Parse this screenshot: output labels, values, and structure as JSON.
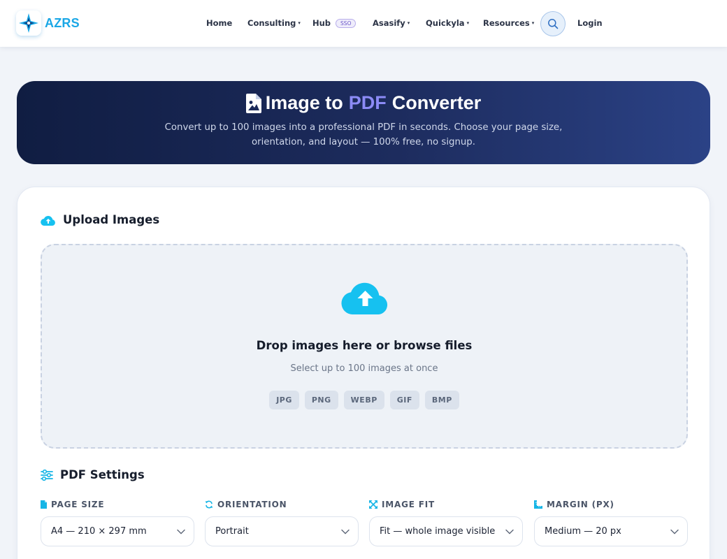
{
  "brand": {
    "name": "AZRS",
    "logo_icon": "compass-star-icon"
  },
  "nav": {
    "items": [
      {
        "label": "Home",
        "has_caret": false
      },
      {
        "label": "Consulting",
        "has_caret": true
      },
      {
        "label": "Hub",
        "badge": "SSO",
        "has_caret": false
      },
      {
        "label": "Asasify",
        "has_caret": true
      },
      {
        "label": "Quickyla",
        "has_caret": true
      },
      {
        "label": "Resources",
        "has_caret": true
      }
    ],
    "caret": "▾",
    "search_icon": "search-icon",
    "login_label": "Login"
  },
  "hero": {
    "title_prefix": "Image to",
    "title_accent": "PDF",
    "title_suffix": "Converter",
    "subtitle": "Convert up to 100 images into a professional PDF in seconds. Choose your page size, orientation, and layout — 100% free, no signup."
  },
  "upload": {
    "heading": "Upload Images",
    "drop_title": "Drop images here or browse files",
    "drop_hint": "Select up to 100 images at once",
    "formats": [
      "JPG",
      "PNG",
      "WEBP",
      "GIF",
      "BMP"
    ]
  },
  "settings": {
    "heading": "PDF Settings",
    "fields": [
      {
        "label": "PAGE SIZE",
        "value": "A4 — 210 × 297 mm",
        "icon": "file-icon"
      },
      {
        "label": "ORIENTATION",
        "value": "Portrait",
        "icon": "sync-icon"
      },
      {
        "label": "IMAGE FIT",
        "value": "Fit — whole image visible",
        "icon": "expand-icon"
      },
      {
        "label": "MARGIN (PX)",
        "value": "Medium — 20 px",
        "icon": "ruler-icon"
      }
    ]
  },
  "colors": {
    "accent_cyan": "#16c1f0",
    "brand_blue": "#1aa7e6",
    "hero_accent": "#8c8bf6",
    "hero_bg_dark": "#101d42"
  }
}
